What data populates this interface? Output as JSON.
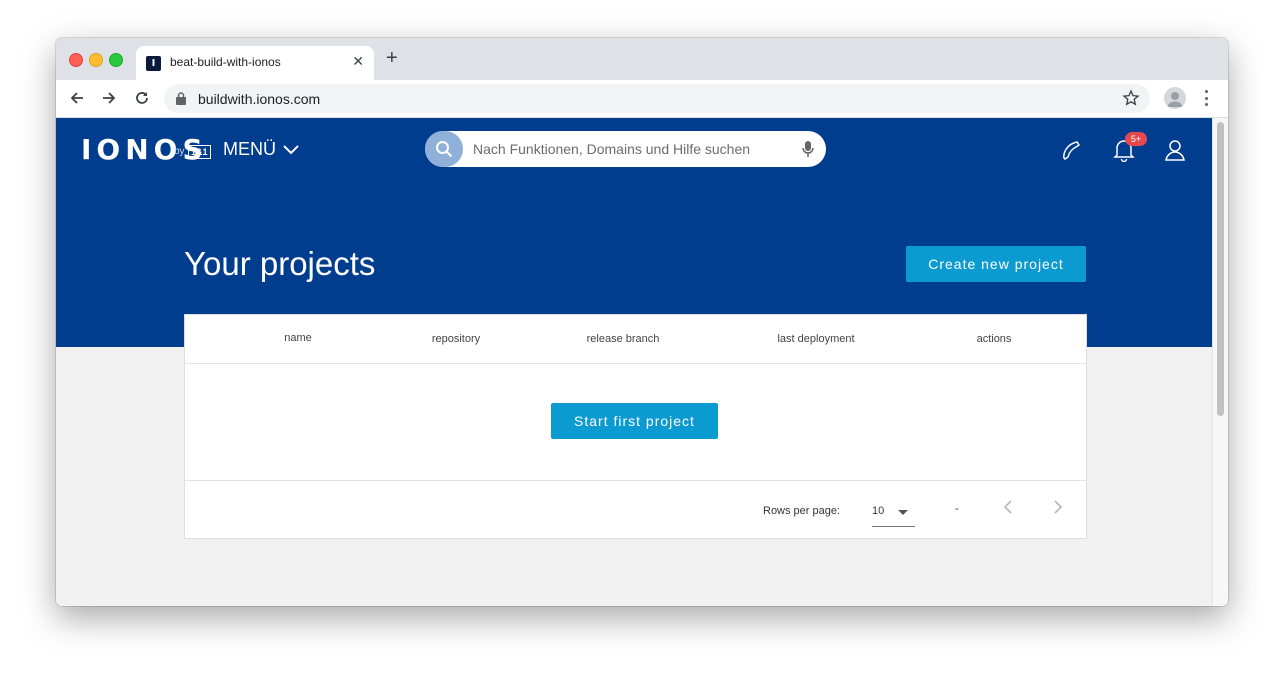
{
  "browser": {
    "tab_title": "beat-build-with-ionos",
    "favicon_letter": "I",
    "new_tab": "+",
    "close_glyph": "✕",
    "url": "buildwith.ionos.com"
  },
  "header": {
    "logo": "IONOS",
    "logo_by": "by",
    "logo_badge": "1&1",
    "menu_label": "MENÜ",
    "search_placeholder": "Nach Funktionen, Domains und Hilfe suchen",
    "notification_badge": "5+",
    "background": "#003d8f"
  },
  "main": {
    "title": "Your projects",
    "create_button": "Create new project",
    "start_button": "Start first project",
    "accent": "#0b9bd1"
  },
  "table": {
    "columns": [
      "name",
      "repository",
      "release branch",
      "last deployment",
      "actions"
    ]
  },
  "pagination": {
    "rows_per_page_label": "Rows per page:",
    "rows_per_page_value": "10",
    "range": "-"
  },
  "icons": [
    "back-icon",
    "forward-icon",
    "reload-icon",
    "lock-icon",
    "star-icon",
    "profile-icon",
    "kebab-icon",
    "search-icon",
    "mic-icon",
    "phone-icon",
    "bell-icon",
    "user-icon",
    "chevron-down-icon",
    "chevron-left-icon",
    "chevron-right-icon"
  ]
}
